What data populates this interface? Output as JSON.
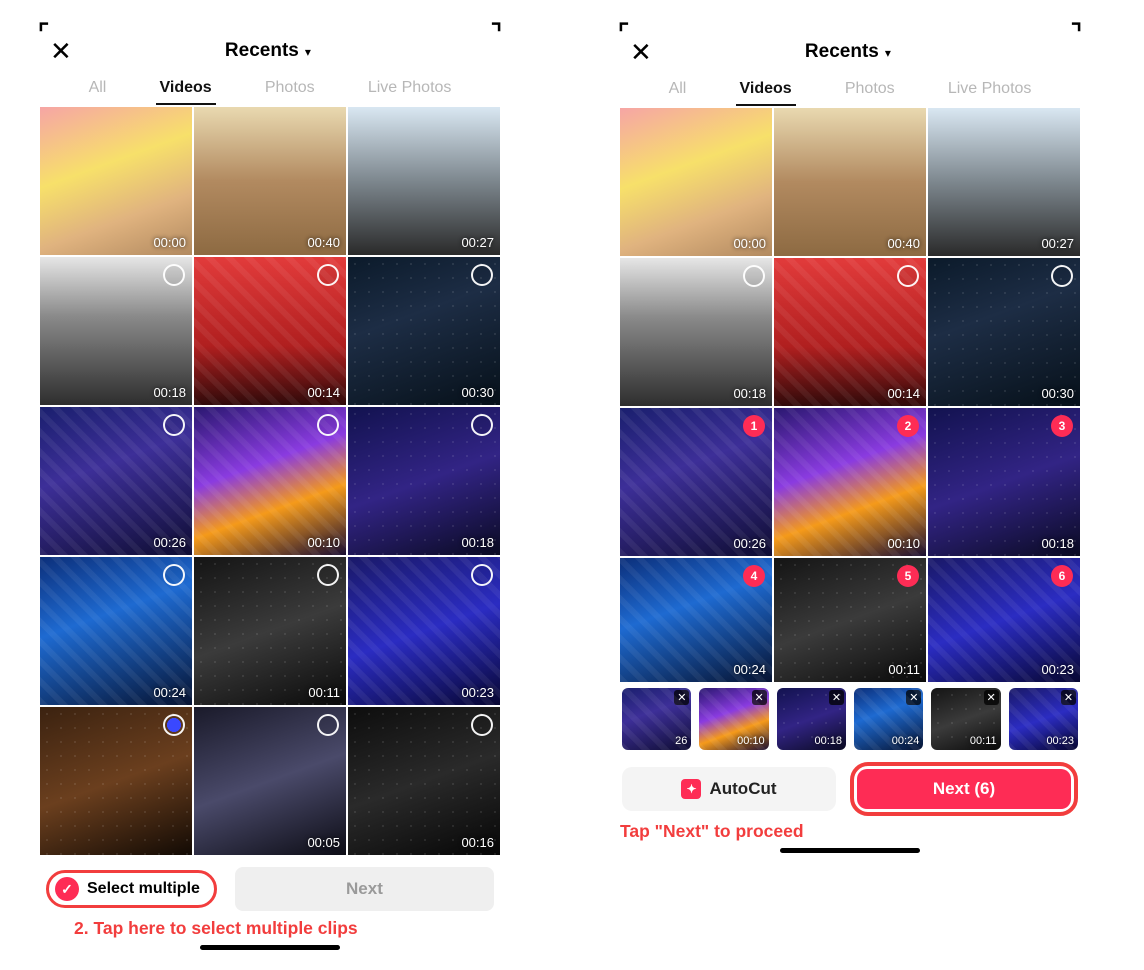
{
  "colors": {
    "accent": "#fe2c55",
    "annotation": "#f23d3d"
  },
  "left": {
    "title": "Recents",
    "tabs": [
      "All",
      "Videos",
      "Photos",
      "Live Photos"
    ],
    "active_tab": "Videos",
    "grid": [
      {
        "duration": "00:00",
        "selectable": false
      },
      {
        "duration": "00:40",
        "selectable": false
      },
      {
        "duration": "00:27",
        "selectable": false
      },
      {
        "duration": "00:18",
        "selectable": true
      },
      {
        "duration": "00:14",
        "selectable": true
      },
      {
        "duration": "00:30",
        "selectable": true
      },
      {
        "duration": "00:26",
        "selectable": true
      },
      {
        "duration": "00:10",
        "selectable": true
      },
      {
        "duration": "00:18",
        "selectable": true
      },
      {
        "duration": "00:24",
        "selectable": true
      },
      {
        "duration": "00:11",
        "selectable": true
      },
      {
        "duration": "00:23",
        "selectable": true
      },
      {
        "duration": "",
        "selectable": true,
        "blue": true
      },
      {
        "duration": "00:05",
        "selectable": true
      },
      {
        "duration": "00:16",
        "selectable": true
      }
    ],
    "select_multiple_label": "Select multiple",
    "next_label": "Next",
    "caption": "2. Tap here to select multiple clips"
  },
  "right": {
    "title": "Recents",
    "tabs": [
      "All",
      "Videos",
      "Photos",
      "Live Photos"
    ],
    "active_tab": "Videos",
    "grid": [
      {
        "duration": "00:00",
        "selectable": false
      },
      {
        "duration": "00:40",
        "selectable": false
      },
      {
        "duration": "00:27",
        "selectable": false
      },
      {
        "duration": "00:18",
        "selectable": true
      },
      {
        "duration": "00:14",
        "selectable": true
      },
      {
        "duration": "00:30",
        "selectable": true
      },
      {
        "duration": "00:26",
        "selectable": true,
        "badge": 1
      },
      {
        "duration": "00:10",
        "selectable": true,
        "badge": 2
      },
      {
        "duration": "00:18",
        "selectable": true,
        "badge": 3
      },
      {
        "duration": "00:24",
        "selectable": true,
        "badge": 4
      },
      {
        "duration": "00:11",
        "selectable": true,
        "badge": 5
      },
      {
        "duration": "00:23",
        "selectable": true,
        "badge": 6
      }
    ],
    "selected_strip": [
      {
        "duration": "26"
      },
      {
        "duration": "00:10"
      },
      {
        "duration": "00:18"
      },
      {
        "duration": "00:24"
      },
      {
        "duration": "00:11"
      },
      {
        "duration": "00:23"
      }
    ],
    "autocut_label": "AutoCut",
    "next_label": "Next (6)",
    "caption": "Tap \"Next\" to proceed"
  }
}
